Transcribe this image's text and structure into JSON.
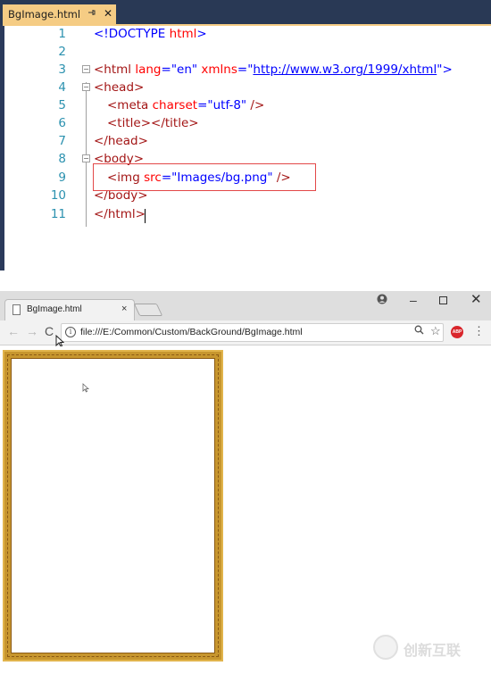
{
  "editor": {
    "tab_title": "BgImage.html",
    "pin_icon": "pin-icon",
    "close_glyph": "✕",
    "lines": [
      {
        "n": "1",
        "fold": ""
      },
      {
        "n": "2",
        "fold": ""
      },
      {
        "n": "3",
        "fold": "−"
      },
      {
        "n": "4",
        "fold": "−"
      },
      {
        "n": "5",
        "fold": ""
      },
      {
        "n": "6",
        "fold": ""
      },
      {
        "n": "7",
        "fold": ""
      },
      {
        "n": "8",
        "fold": "−"
      },
      {
        "n": "9",
        "fold": ""
      },
      {
        "n": "10",
        "fold": ""
      },
      {
        "n": "11",
        "fold": ""
      }
    ],
    "code": {
      "l1": {
        "doctype": "<!DOCTYPE",
        "rest": " html",
        "close": ">"
      },
      "l3": {
        "open": "<html",
        "attr1": " lang",
        "eq1": "=",
        "val1": "\"en\"",
        "attr2": " xmlns",
        "eq2": "=",
        "q1": "\"",
        "url": "http://www.w3.org/1999/xhtml",
        "q2": "\"",
        "close": ">"
      },
      "l4": {
        "tag": "<head>"
      },
      "l5": {
        "open": "<meta",
        "attr": " charset",
        "eq": "=",
        "val": "\"utf-8\"",
        "close": " />"
      },
      "l6": {
        "open": "<title>",
        "close": "</title>"
      },
      "l7": {
        "tag": "</head>"
      },
      "l8": {
        "tag": "<body>"
      },
      "l9": {
        "open": "<img",
        "attr": " src",
        "eq": "=",
        "val": "\"Images/bg.png\"",
        "close": " />"
      },
      "l10": {
        "tag": "</body>"
      },
      "l11": {
        "tag": "</html>"
      }
    }
  },
  "browser": {
    "tab_title": "BgImage.html",
    "tab_close": "×",
    "window_controls": {
      "user": "user-icon",
      "minimize": "–",
      "maximize": "maximize-icon",
      "close": "✕"
    },
    "nav": {
      "back": "←",
      "forward": "→",
      "reload": "C"
    },
    "url": "file:///E:/Common/Custom/BackGround/BgImage.html",
    "info_glyph": "i",
    "zoom_glyph": "🔍",
    "star_glyph": "☆",
    "abp_label": "ABP",
    "menu_glyph": "⋮"
  },
  "watermark": {
    "text": "创新互联"
  }
}
